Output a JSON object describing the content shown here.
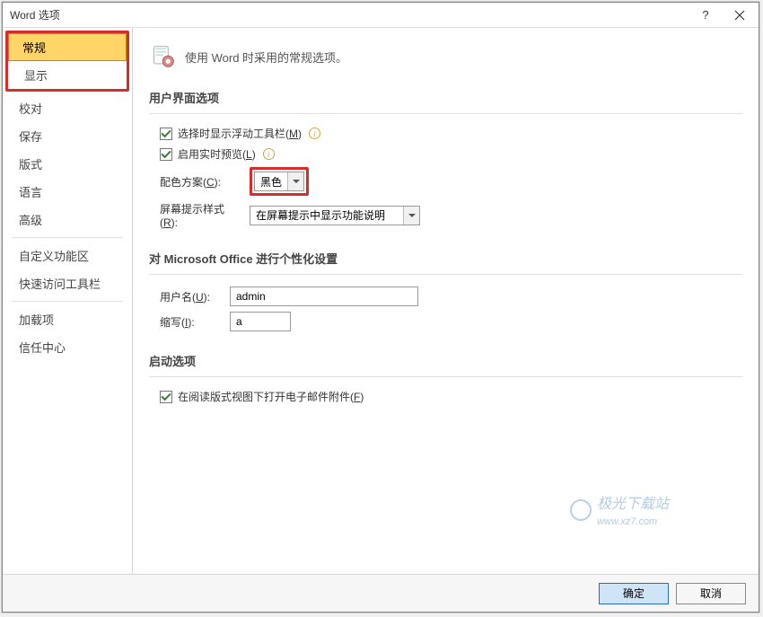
{
  "title": "Word 选项",
  "sidebar": {
    "items": [
      {
        "label": "常规"
      },
      {
        "label": "显示"
      },
      {
        "label": "校对"
      },
      {
        "label": "保存"
      },
      {
        "label": "版式"
      },
      {
        "label": "语言"
      },
      {
        "label": "高级"
      },
      {
        "label": "自定义功能区"
      },
      {
        "label": "快速访问工具栏"
      },
      {
        "label": "加载项"
      },
      {
        "label": "信任中心"
      }
    ]
  },
  "header": {
    "text": "使用 Word 时采用的常规选项。"
  },
  "sections": {
    "ui_options": {
      "title": "用户界面选项",
      "show_mini_toolbar_prefix": "选择时显示浮动工具栏(",
      "show_mini_toolbar_letter": "M",
      "show_mini_toolbar_suffix": ")",
      "live_preview_prefix": "启用实时预览(",
      "live_preview_letter": "L",
      "live_preview_suffix": ")",
      "color_scheme_label_prefix": "配色方案(",
      "color_scheme_letter": "C",
      "color_scheme_suffix": "):",
      "color_scheme_value": "黑色",
      "screentip_label_prefix": "屏幕提示样式(",
      "screentip_letter": "R",
      "screentip_suffix": "):",
      "screentip_value": "在屏幕提示中显示功能说明"
    },
    "personalize": {
      "title": "对 Microsoft Office 进行个性化设置",
      "username_label_prefix": "用户名(",
      "username_letter": "U",
      "username_suffix": "):",
      "username_value": "admin",
      "initials_label_prefix": "缩写(",
      "initials_letter": "I",
      "initials_suffix": "):",
      "initials_value": "a"
    },
    "startup": {
      "title": "启动选项",
      "open_attachments_prefix": "在阅读版式视图下打开电子邮件附件(",
      "open_attachments_letter": "F",
      "open_attachments_suffix": ")"
    }
  },
  "footer": {
    "ok": "确定",
    "cancel": "取消"
  },
  "watermark": {
    "text": "极光下载站",
    "url": "www.xz7.com"
  }
}
